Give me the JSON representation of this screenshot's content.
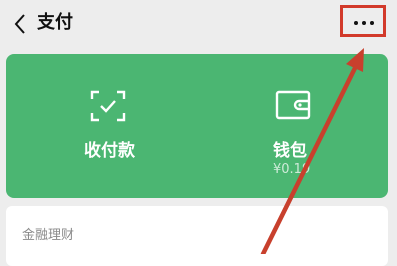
{
  "nav": {
    "title": "支付",
    "back_icon": "chevron-left-icon",
    "more_icon": "more-dots-icon"
  },
  "card": {
    "background_color": "#4bb672",
    "pay": {
      "label": "收付款",
      "icon": "scan-frame-check-icon"
    },
    "wallet": {
      "label": "钱包",
      "balance": "¥0.19",
      "icon": "wallet-icon"
    }
  },
  "finance": {
    "title": "金融理财"
  },
  "annotation": {
    "highlight_color": "#d23a2a"
  }
}
